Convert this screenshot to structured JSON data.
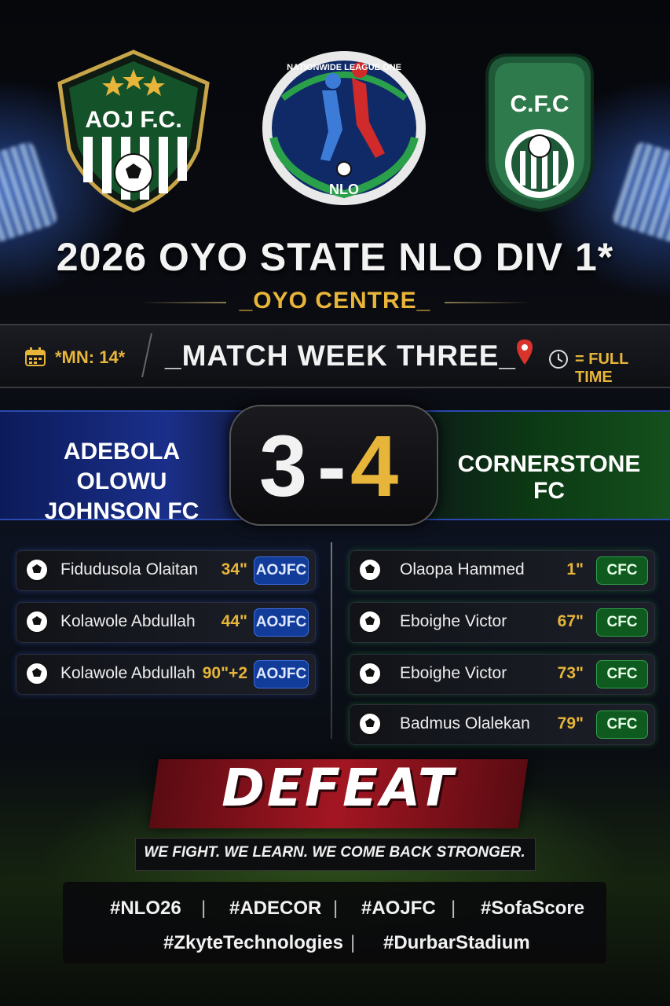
{
  "header": {
    "title": "2026 OYO STATE NLO DIV 1*",
    "subtitle": "_OYO CENTRE_"
  },
  "crests": {
    "home": {
      "text": "AOJ F.C."
    },
    "league": {
      "arc_text": "NATIONWIDE LEAGUE ONE",
      "short": "NLO"
    },
    "away": {
      "text": "C.F.C"
    }
  },
  "info_bar": {
    "match_number": "*MN: 14*",
    "match_week": "_MATCH WEEK THREE_",
    "status": "= FULL TIME"
  },
  "score": {
    "home_team_line1": "ADEBOLA OLOWU",
    "home_team_line2": "JOHNSON FC",
    "home_score": "3",
    "dash": "-",
    "away_score": "4",
    "away_team": "CORNERSTONE FC"
  },
  "scorers": {
    "home": [
      {
        "name": "Fidudusola Olaitan",
        "minute": "34\"",
        "team": "AOJFC"
      },
      {
        "name": "Kolawole Abdullah",
        "minute": "44\"",
        "team": "AOJFC"
      },
      {
        "name": "Kolawole Abdullah",
        "minute": "90\"+2",
        "team": "AOJFC"
      }
    ],
    "away": [
      {
        "name": "Olaopa Hammed",
        "minute": "1\"",
        "team": "CFC"
      },
      {
        "name": "Eboighe Victor",
        "minute": "67\"",
        "team": "CFC"
      },
      {
        "name": "Eboighe Victor",
        "minute": "73\"",
        "team": "CFC"
      },
      {
        "name": "Badmus Olalekan",
        "minute": "79\"",
        "team": "CFC"
      }
    ]
  },
  "result": {
    "label": "DEFEAT",
    "slogan": "WE FIGHT. WE LEARN. WE COME BACK STRONGER."
  },
  "hashtags": [
    "#NLO26",
    "#ADECOR",
    "#AOJFC",
    "#SofaScore",
    "#ZkyteTechnologies",
    "#DurbarStadium"
  ],
  "separator": "|",
  "colors": {
    "gold": "#e7b53a",
    "home_blue": "#123c9a",
    "away_green": "#0f5a1e",
    "defeat_red": "#a31622"
  }
}
